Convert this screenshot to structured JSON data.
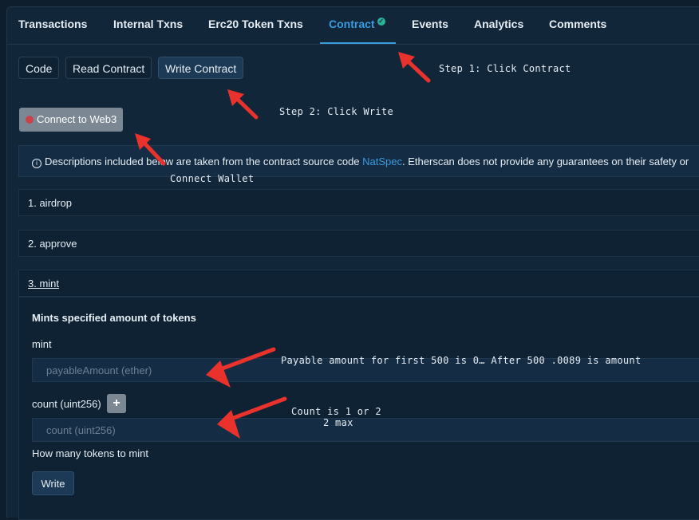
{
  "tabs": [
    {
      "label": "Transactions"
    },
    {
      "label": "Internal Txns"
    },
    {
      "label": "Erc20 Token Txns"
    },
    {
      "label": "Contract",
      "active": true,
      "verified_badge": "check-circle-icon"
    },
    {
      "label": "Events"
    },
    {
      "label": "Analytics"
    },
    {
      "label": "Comments"
    }
  ],
  "subtabs": {
    "code": "Code",
    "read": "Read Contract",
    "write": "Write Contract"
  },
  "connect_label": "Connect to Web3",
  "notice": {
    "before": "Descriptions included below are taken from the contract source code ",
    "link": "NatSpec",
    "after": ". Etherscan does not provide any guarantees on their safety or"
  },
  "functions": [
    {
      "label": "1. airdrop"
    },
    {
      "label": "2. approve"
    },
    {
      "label": "3. mint"
    }
  ],
  "mint_form": {
    "description": "Mints specified amount of tokens",
    "payable_label": "mint",
    "payable_placeholder": "payableAmount (ether)",
    "count_label": "count (uint256)",
    "plus_label": "+",
    "count_placeholder": "count (uint256)",
    "count_hint": "How many tokens to mint",
    "write_label": "Write"
  },
  "annotations": {
    "step1": "Step 1: Click Contract",
    "step2": "Step 2: Click Write",
    "connect": "Connect Wallet",
    "payable": "Payable amount for first 500 is 0… After 500 .0089 is amount",
    "count_line1": "Count is 1 or 2",
    "count_line2": "2 max"
  },
  "colors": {
    "accent": "#3a9bdc",
    "arrow": "#e8322b",
    "verified": "#2ab396"
  }
}
